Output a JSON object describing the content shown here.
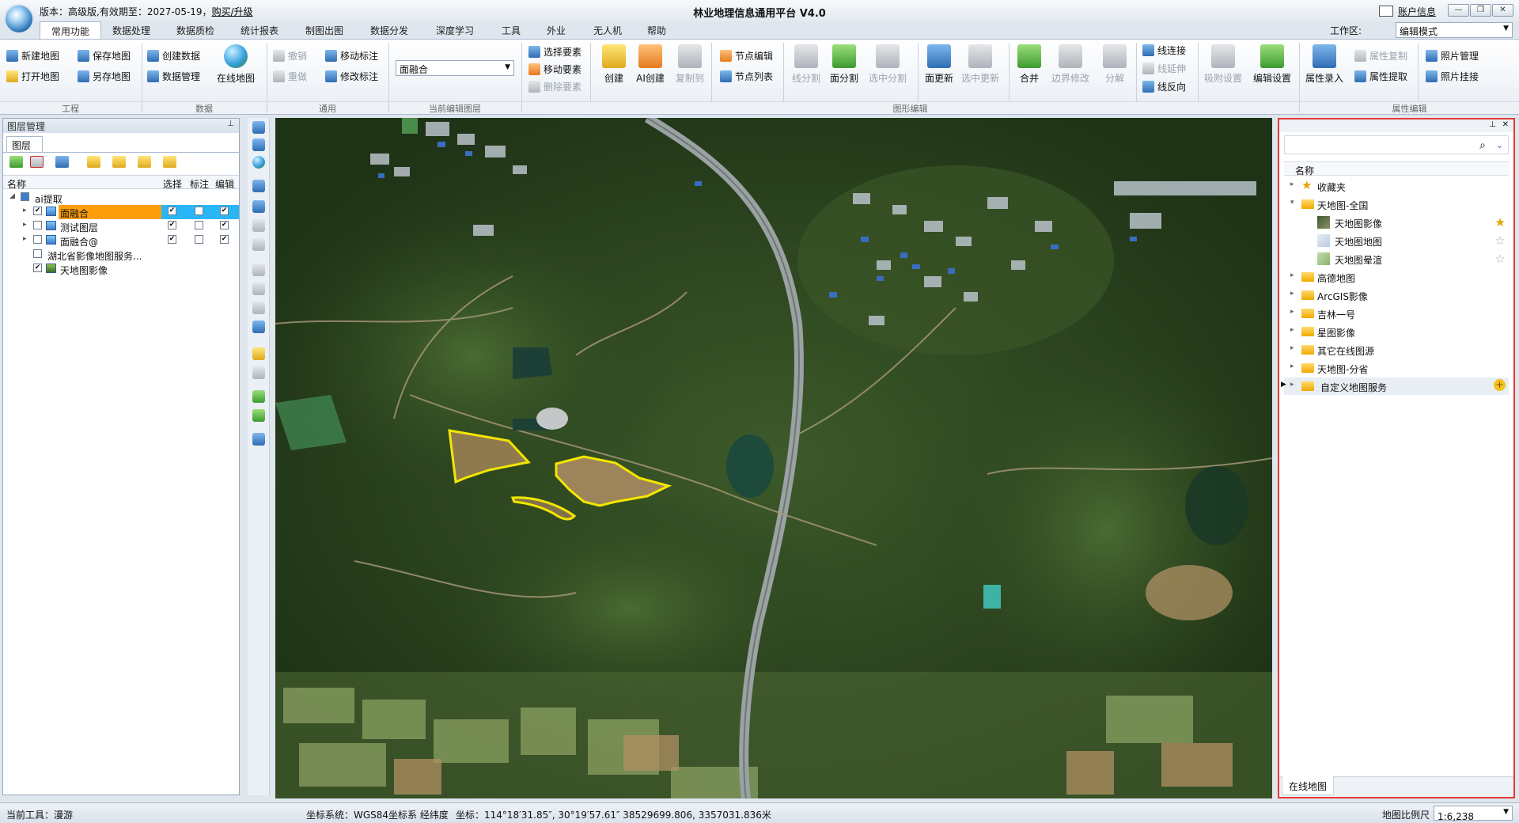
{
  "titlebar": {
    "version_text": "版本：高级版,有效期至：2027-05-19，",
    "buy_link": "购买/升级",
    "app_title": "林业地理信息通用平台 V4.0",
    "account_label": "账户信息",
    "win_minimize": "—",
    "win_restore": "❐",
    "win_close": "✕"
  },
  "menu_tabs": [
    "常用功能",
    "数据处理",
    "数据质检",
    "统计报表",
    "制图出图",
    "数据分发",
    "深度学习",
    "工具",
    "外业",
    "无人机",
    "帮助"
  ],
  "workarea": {
    "label": "工作区:",
    "value": "编辑模式"
  },
  "ribbon": {
    "groups": [
      "工程",
      "数据",
      "通用",
      "当前编辑图层",
      "图形编辑",
      "属性编辑"
    ],
    "project": [
      "新建地图",
      "保存地图",
      "打开地图",
      "另存地图"
    ],
    "data": [
      "创建数据",
      "数据管理",
      "在线地图"
    ],
    "general": [
      "撤销",
      "移动标注",
      "重做",
      "修改标注"
    ],
    "current_layer": "面融合",
    "select": [
      "选择要素",
      "移动要素",
      "删除要素"
    ],
    "big_buttons": [
      "创建",
      "AI创建",
      "复制到"
    ],
    "node": [
      "节点编辑",
      "节点列表"
    ],
    "geom": [
      "线分割",
      "面分割",
      "选中分割",
      "面更新",
      "选中更新",
      "合并",
      "边界修改",
      "分解"
    ],
    "line": [
      "线连接",
      "线延伸",
      "线反向"
    ],
    "settings": [
      "吸附设置",
      "编辑设置"
    ],
    "attr": [
      "属性录入",
      "属性复制",
      "属性提取"
    ],
    "photo": [
      "照片管理",
      "照片挂接"
    ]
  },
  "layer_panel": {
    "title": "图层管理",
    "tab": "图层",
    "columns": [
      "名称",
      "选择",
      "标注",
      "编辑"
    ],
    "group_name": "ai提取",
    "layers": [
      {
        "name": "面融合",
        "visible": true,
        "select": true,
        "label": false,
        "edit": true,
        "selected": true
      },
      {
        "name": "测试图层",
        "visible": false,
        "select": true,
        "label": false,
        "edit": true,
        "selected": false
      },
      {
        "name": "面融合@",
        "visible": false,
        "select": true,
        "label": false,
        "edit": true,
        "selected": false
      }
    ],
    "base_layers": [
      {
        "name": "湖北省影像地图服务...",
        "visible": false
      },
      {
        "name": "天地图影像",
        "visible": true
      }
    ]
  },
  "online_panel": {
    "column": "名称",
    "favorites": "收藏夹",
    "tdt_national": "天地图-全国",
    "tdt_items": [
      {
        "name": "天地图影像",
        "starred": true
      },
      {
        "name": "天地图地图",
        "starred": false
      },
      {
        "name": "天地图晕渲",
        "starred": false
      }
    ],
    "folders": [
      "高德地图",
      "ArcGIS影像",
      "吉林一号",
      "星图影像",
      "其它在线图源",
      "天地图-分省",
      "自定义地图服务"
    ],
    "tab": "在线地图"
  },
  "statusbar": {
    "tool": "当前工具：漫游",
    "crs": "坐标系统：WGS84坐标系 经纬度",
    "coords": "坐标：114°18′31.85″, 30°19′57.61″   38529699.806, 3357031.836米",
    "scale_label": "地图比例尺",
    "scale_value": "1:6,238"
  },
  "colors": {
    "accent_selected": "#ff9e0c",
    "highlight_row": "#29b6f6",
    "panel_border": "#e53935",
    "polygon_outline": "#f3e600"
  }
}
